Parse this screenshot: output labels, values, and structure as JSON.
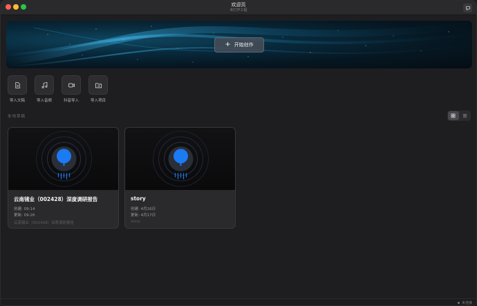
{
  "window": {
    "title": "欢迎页",
    "subtitle": "未打开工程"
  },
  "banner": {
    "start_label": "开始创作",
    "start_icon": "plus-icon"
  },
  "quick_actions": [
    {
      "label": "导入文稿",
      "icon": "document-icon"
    },
    {
      "label": "导入音频",
      "icon": "music-note-icon"
    },
    {
      "label": "抖音导入",
      "icon": "video-camera-icon"
    },
    {
      "label": "导入项目",
      "icon": "folder-import-icon"
    }
  ],
  "drafts": {
    "section_label": "本地草稿",
    "view_modes": [
      "grid",
      "list"
    ],
    "active_view": "grid",
    "items": [
      {
        "title": "云南锗业（002428）深度调研报告",
        "created": "创建: 09:14",
        "updated": "更新: 09:26",
        "description": "云南锗业（002428）深度调研报告"
      },
      {
        "title": "story",
        "created": "创建: 4月16日",
        "updated": "更新: 4月17日",
        "description": "story"
      }
    ]
  },
  "status": {
    "connection": "未连接"
  },
  "colors": {
    "accent": "#1a7bf2",
    "background": "#1e1e20",
    "card": "#2a2a2d"
  }
}
